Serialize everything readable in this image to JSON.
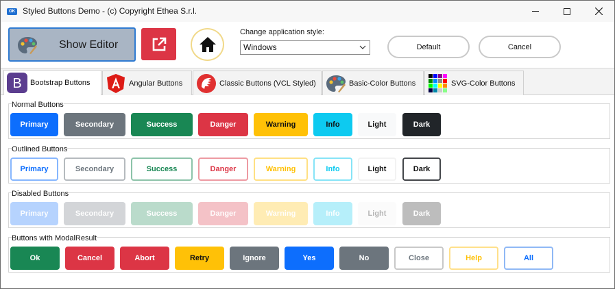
{
  "window": {
    "icon_text": "OK",
    "title": "Styled Buttons Demo - (c) Copyright Ethea S.r.l."
  },
  "toolbar": {
    "show_editor_label": "Show Editor",
    "style_label": "Change application style:",
    "style_value": "Windows",
    "default_label": "Default",
    "cancel_label": "Cancel"
  },
  "tabs": [
    {
      "label": "Bootstrap Buttons",
      "icon": "bootstrap-icon",
      "active": true
    },
    {
      "label": "Angular Buttons",
      "icon": "angular-icon",
      "active": false
    },
    {
      "label": "Classic Buttons (VCL Styled)",
      "icon": "delphi-helmet-icon",
      "active": false
    },
    {
      "label": "Basic-Color Buttons",
      "icon": "palette-icon",
      "active": false
    },
    {
      "label": "SVG-Color Buttons",
      "icon": "color-grid-icon",
      "active": false
    }
  ],
  "groups": {
    "normal": {
      "title": "Normal Buttons",
      "buttons": [
        "Primary",
        "Secondary",
        "Success",
        "Danger",
        "Warning",
        "Info",
        "Light",
        "Dark"
      ]
    },
    "outlined": {
      "title": "Outlined Buttons",
      "buttons": [
        "Primary",
        "Secondary",
        "Success",
        "Danger",
        "Warning",
        "Info",
        "Light",
        "Dark"
      ]
    },
    "disabled": {
      "title": "Disabled Buttons",
      "buttons": [
        "Primary",
        "Secondary",
        "Success",
        "Danger",
        "Warning",
        "Info",
        "Light",
        "Dark"
      ]
    },
    "modal": {
      "title": "Buttons with ModalResult",
      "buttons": [
        "Ok",
        "Cancel",
        "Abort",
        "Retry",
        "Ignore",
        "Yes",
        "No",
        "Close",
        "Help",
        "All"
      ]
    }
  },
  "colors": {
    "primary": "#0d6efd",
    "secondary": "#6c757d",
    "success": "#198754",
    "danger": "#dc3545",
    "warning": "#ffc107",
    "info": "#0dcaf0",
    "light": "#f8f9fa",
    "dark": "#212529"
  }
}
